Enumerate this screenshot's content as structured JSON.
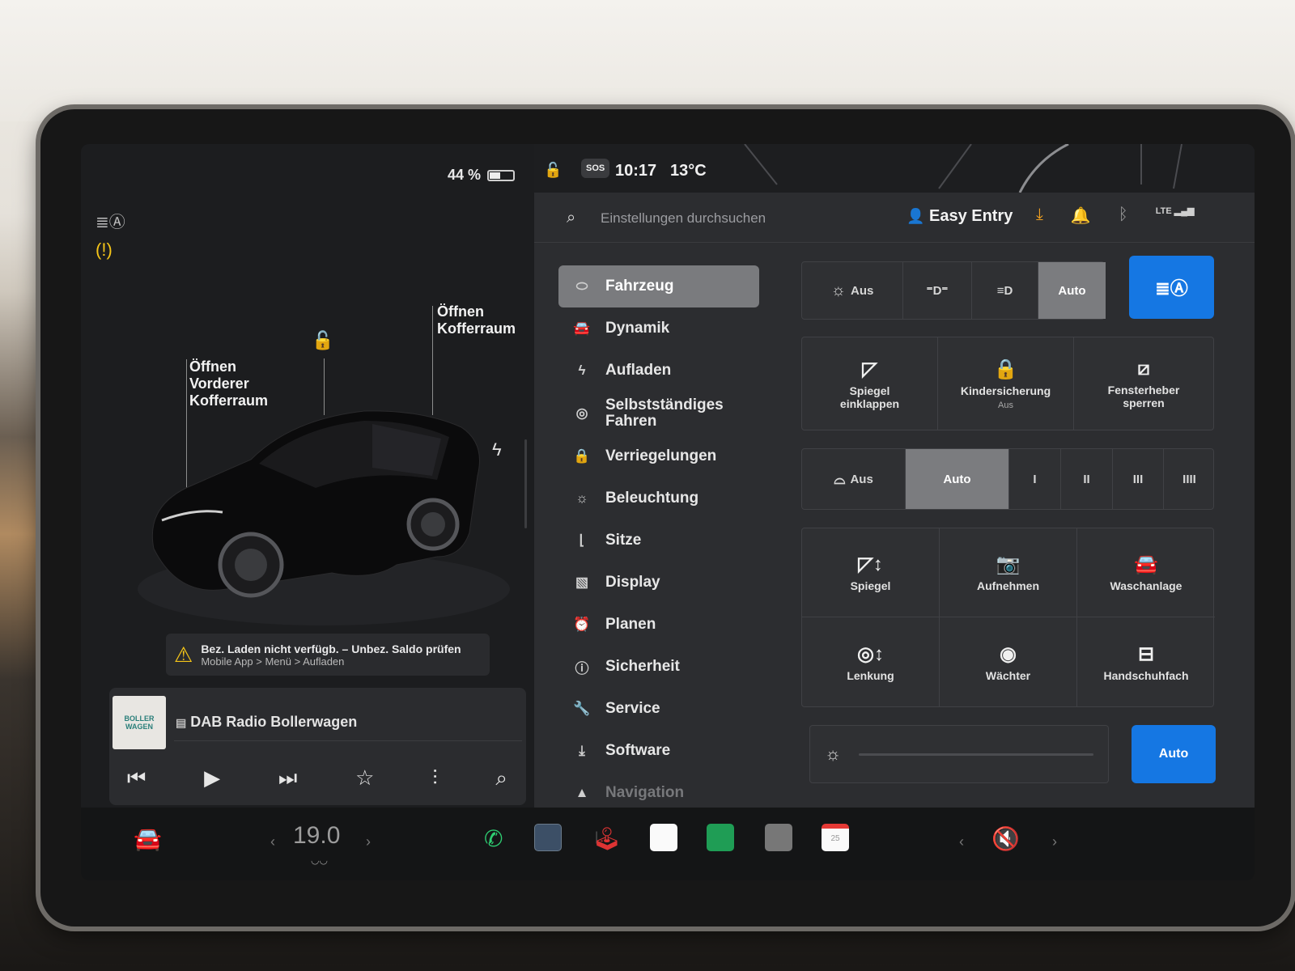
{
  "status": {
    "battery_percent": "44 %",
    "battery_level": 0.44,
    "time": "10:17",
    "temperature": "13°C",
    "sos": "SOS"
  },
  "left_panel": {
    "frunk_label": "Öffnen\nVorderer\nKofferraum",
    "trunk_label": "Öffnen\nKofferraum",
    "alert_line1": "Bez. Laden nicht verfügb. – Unbez. Saldo prüfen",
    "alert_line2": "Mobile App > Menü > Aufladen",
    "media": {
      "album_art_text": "BOLLER WAGEN",
      "title": "DAB Radio Bollerwagen"
    }
  },
  "header": {
    "search_placeholder": "Einstellungen durchsuchen",
    "profile_name": "Easy Entry",
    "network": "LTE"
  },
  "nav": {
    "items": [
      {
        "label": "Fahrzeug",
        "icon": "toggle-icon"
      },
      {
        "label": "Dynamik",
        "icon": "car-icon"
      },
      {
        "label": "Aufladen",
        "icon": "bolt-icon"
      },
      {
        "label": "Selbstständiges Fahren",
        "icon": "steering-wheel-icon"
      },
      {
        "label": "Verriegelungen",
        "icon": "lock-icon"
      },
      {
        "label": "Beleuchtung",
        "icon": "sun-icon"
      },
      {
        "label": "Sitze",
        "icon": "seat-icon"
      },
      {
        "label": "Display",
        "icon": "display-icon"
      },
      {
        "label": "Planen",
        "icon": "clock-icon"
      },
      {
        "label": "Sicherheit",
        "icon": "info-icon"
      },
      {
        "label": "Service",
        "icon": "wrench-icon"
      },
      {
        "label": "Software",
        "icon": "download-icon"
      },
      {
        "label": "Navigation",
        "icon": "navigation-icon"
      }
    ]
  },
  "lights": {
    "off_label": "Aus",
    "auto_label": "Auto",
    "selected": "Auto"
  },
  "tiles_row1": [
    {
      "label": "Spiegel einklappen",
      "sub": ""
    },
    {
      "label": "Kindersicherung",
      "sub": "Aus"
    },
    {
      "label": "Fensterheber sperren",
      "sub": ""
    }
  ],
  "wipers": {
    "off_label": "Aus",
    "auto_label": "Auto",
    "speeds": [
      "I",
      "II",
      "III",
      "IIII"
    ],
    "selected": "Auto"
  },
  "tiles_grid": [
    {
      "label": "Spiegel"
    },
    {
      "label": "Aufnehmen"
    },
    {
      "label": "Waschanlage"
    },
    {
      "label": "Lenkung"
    },
    {
      "label": "Wächter"
    },
    {
      "label": "Handschuhfach"
    }
  ],
  "brightness": {
    "auto_label": "Auto"
  },
  "dock": {
    "temperature": "19.0",
    "calendar_day": "25"
  },
  "colors": {
    "accent_blue": "#1577e3",
    "warning_yellow": "#f5c518",
    "phone_green": "#2ecc71"
  }
}
